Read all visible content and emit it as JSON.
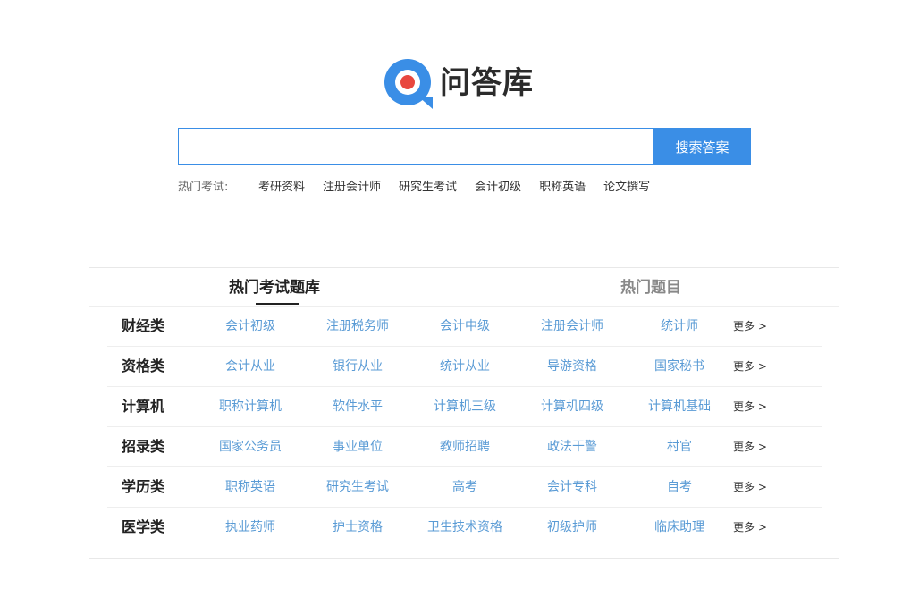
{
  "brand": {
    "name": "问答库",
    "colors": {
      "blue": "#3a8ee6",
      "red": "#e8473f"
    }
  },
  "search": {
    "placeholder": "",
    "button_label": "搜索答案"
  },
  "hot_exams": {
    "label": "热门考试:",
    "links": [
      "考研资料",
      "注册会计师",
      "研究生考试",
      "会计初级",
      "职称英语",
      "论文撰写"
    ]
  },
  "tabs": [
    {
      "label": "热门考试题库",
      "active": true
    },
    {
      "label": "热门题目",
      "active": false
    }
  ],
  "categories": [
    {
      "label": "财经类",
      "items": [
        "会计初级",
        "注册税务师",
        "会计中级",
        "注册会计师",
        "统计师"
      ],
      "more": "更多 >"
    },
    {
      "label": "资格类",
      "items": [
        "会计从业",
        "银行从业",
        "统计从业",
        "导游资格",
        "国家秘书"
      ],
      "more": "更多 >"
    },
    {
      "label": "计算机",
      "items": [
        "职称计算机",
        "软件水平",
        "计算机三级",
        "计算机四级",
        "计算机基础"
      ],
      "more": "更多 >"
    },
    {
      "label": "招录类",
      "items": [
        "国家公务员",
        "事业单位",
        "教师招聘",
        "政法干警",
        "村官"
      ],
      "more": "更多 >"
    },
    {
      "label": "学历类",
      "items": [
        "职称英语",
        "研究生考试",
        "高考",
        "会计专科",
        "自考"
      ],
      "more": "更多 >"
    },
    {
      "label": "医学类",
      "items": [
        "执业药师",
        "护士资格",
        "卫生技术资格",
        "初级护师",
        "临床助理"
      ],
      "more": "更多 >"
    }
  ]
}
